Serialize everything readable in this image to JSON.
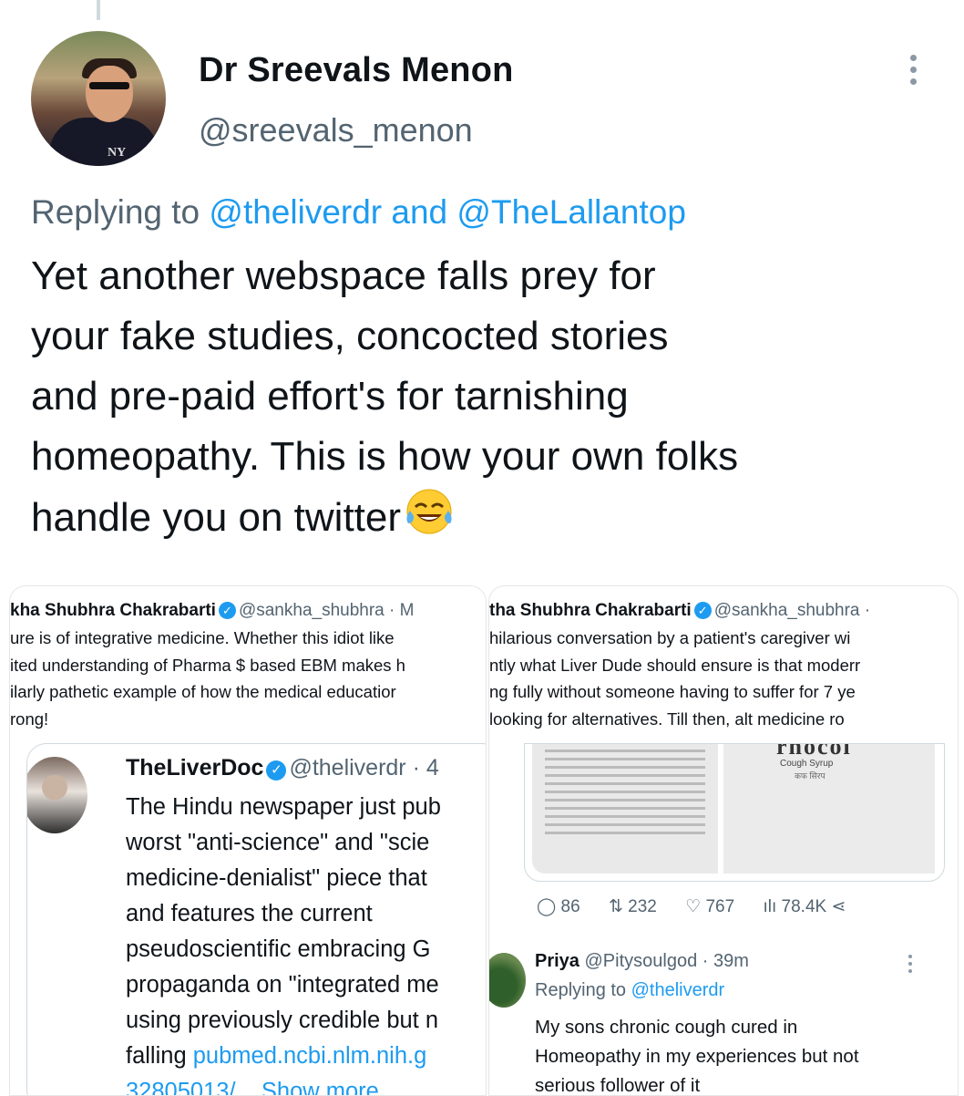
{
  "author": {
    "name": "Dr Sreevals Menon",
    "handle": "@sreevals_menon"
  },
  "reply": {
    "prefix": "Replying to",
    "mention1": "@theliverdr",
    "conj": "and",
    "mention2": "@TheLallantop"
  },
  "tweet": {
    "line1": "Yet another webspace falls prey for",
    "line2": "your fake studies, concocted stories",
    "line3": "and pre-paid effort's for tarnishing",
    "line4": "homeopathy. This is how your own folks",
    "line5": "handle you on twitter"
  },
  "screenshot_left": {
    "header_name": "kha Shubhra Chakrabarti",
    "header_handle": "@sankha_shubhra · M",
    "body": "ure is of integrative medicine. Whether this idiot like\nited understanding of Pharma $ based EBM makes h\nilarly pathetic example of how the medical educatior\nrong!",
    "quoted_name": "TheLiverDoc",
    "quoted_handle": "@theliverdr · 4",
    "quoted_text": "The Hindu newspaper just pub\nworst \"anti-science\" and \"scie\nmedicine-denialist\" piece that\nand features the current\npseudoscientific embracing G\npropaganda on \"integrated me\nusing previously credible but n",
    "quoted_last_prefix": "falling ",
    "quoted_link": "pubmed.ncbi.nlm.nih.g",
    "quoted_link2": "32805013/... Show more"
  },
  "screenshot_right": {
    "header_name": "tha Shubhra Chakrabarti",
    "header_handle": "@sankha_shubhra ·",
    "body": "hilarious conversation by a patient's caregiver wi\nntly what Liver Dude should ensure is that moderr\nng fully without someone having to suffer for 7 ye\nlooking for alternatives. Till then, alt medicine ro",
    "product_brand": "rnocol",
    "product_sub": "Cough Syrup",
    "product_hindi": "कफ सिरप",
    "stats": {
      "replies": "86",
      "retweets": "232",
      "likes": "767",
      "views": "78.4K"
    },
    "reply_name": "Priya",
    "reply_handle": "@Pitysoulgod · 39m",
    "reply_to_prefix": "Replying to",
    "reply_to": "@theliverdr",
    "reply_text": "My sons chronic cough cured in\nHomeopathy in my experiences but not\nserious follower of it"
  },
  "icons": {
    "more": "more-vertical-icon",
    "verified": "verified-badge-icon",
    "reply": "reply-icon",
    "retweet": "retweet-icon",
    "like": "heart-icon",
    "views": "views-icon",
    "share": "share-icon",
    "emoji": "tears-of-joy-emoji"
  },
  "colors": {
    "link": "#1d9bf0",
    "secondary": "#536471",
    "text": "#0f1419"
  }
}
